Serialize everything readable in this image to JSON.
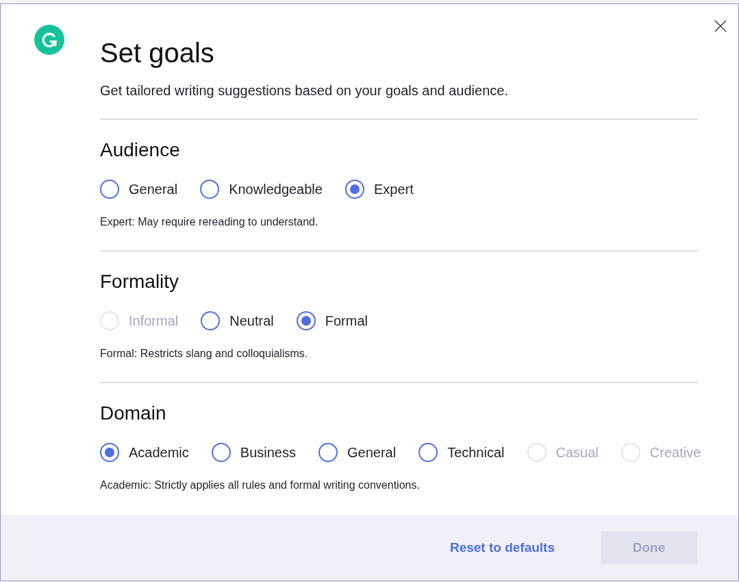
{
  "dialog": {
    "title": "Set goals",
    "subtitle": "Get tailored writing suggestions based on your goals and audience."
  },
  "sections": [
    {
      "title": "Audience",
      "options": [
        {
          "label": "General",
          "selected": false,
          "disabled": false
        },
        {
          "label": "Knowledgeable",
          "selected": false,
          "disabled": false
        },
        {
          "label": "Expert",
          "selected": true,
          "disabled": false
        }
      ],
      "description": "Expert: May require rereading to understand."
    },
    {
      "title": "Formality",
      "options": [
        {
          "label": "Informal",
          "selected": false,
          "disabled": true
        },
        {
          "label": "Neutral",
          "selected": false,
          "disabled": false
        },
        {
          "label": "Formal",
          "selected": true,
          "disabled": false
        }
      ],
      "description": "Formal: Restricts slang and colloquialisms."
    },
    {
      "title": "Domain",
      "options": [
        {
          "label": "Academic",
          "selected": true,
          "disabled": false
        },
        {
          "label": "Business",
          "selected": false,
          "disabled": false
        },
        {
          "label": "General",
          "selected": false,
          "disabled": false
        },
        {
          "label": "Technical",
          "selected": false,
          "disabled": false
        },
        {
          "label": "Casual",
          "selected": false,
          "disabled": true
        },
        {
          "label": "Creative",
          "selected": false,
          "disabled": true
        }
      ],
      "description": "Academic: Strictly applies all rules and formal writing conventions."
    }
  ],
  "footer": {
    "reset_link": "Reset to defaults",
    "done_button": {
      "label": "Done",
      "disabled": true
    }
  }
}
